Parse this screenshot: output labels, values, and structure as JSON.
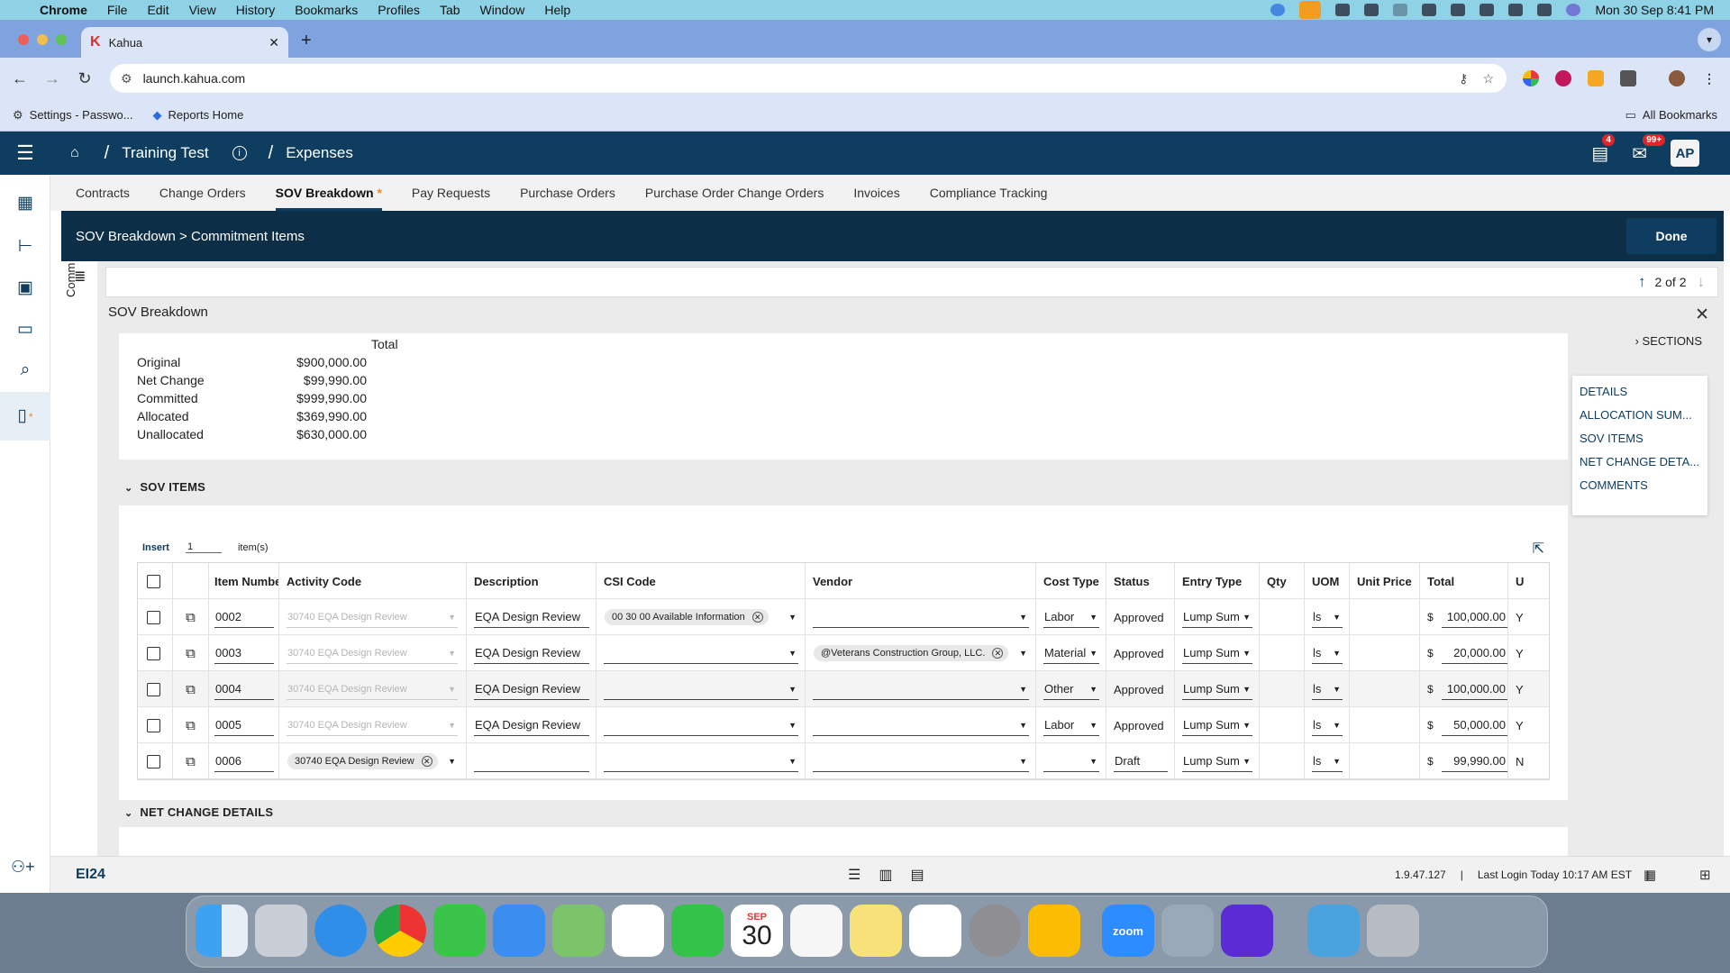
{
  "menubar": {
    "app": "Chrome",
    "items": [
      "File",
      "Edit",
      "View",
      "History",
      "Bookmarks",
      "Profiles",
      "Tab",
      "Window",
      "Help"
    ],
    "datetime": "Mon 30 Sep  8:41 PM"
  },
  "browser": {
    "tab_title": "Kahua",
    "url": "launch.kahua.com",
    "bookmarks": [
      "Settings - Passwo...",
      "Reports Home"
    ],
    "all_bookmarks": "All Bookmarks"
  },
  "app": {
    "breadcrumb": [
      "Training Test",
      "Expenses"
    ],
    "notifications_badge": "4",
    "messages_badge": "99+",
    "avatar": "AP",
    "subnav": [
      {
        "label": "Contracts",
        "active": false
      },
      {
        "label": "Change Orders",
        "active": false
      },
      {
        "label": "SOV Breakdown",
        "active": true,
        "marker": "*"
      },
      {
        "label": "Pay Requests",
        "active": false
      },
      {
        "label": "Purchase Orders",
        "active": false
      },
      {
        "label": "Purchase Order Change Orders",
        "active": false
      },
      {
        "label": "Invoices",
        "active": false
      },
      {
        "label": "Compliance Tracking",
        "active": false
      }
    ],
    "panel_title": "SOV Breakdown > Commitment Items",
    "done_label": "Done",
    "collapsed_label": "Comm",
    "record_position": "2 of 2",
    "form_title": "SOV Breakdown",
    "summary": {
      "header": "Total",
      "rows": [
        {
          "label": "Original",
          "value": "$900,000.00"
        },
        {
          "label": "Net Change",
          "value": "$99,990.00"
        },
        {
          "label": "Committed",
          "value": "$999,990.00"
        },
        {
          "label": "Allocated",
          "value": "$369,990.00"
        },
        {
          "label": "Unallocated",
          "value": "$630,000.00"
        }
      ]
    },
    "sov_section_label": "SOV ITEMS",
    "net_change_section_label": "NET CHANGE DETAILS",
    "insert": {
      "label": "Insert",
      "count": "1",
      "suffix": "item(s)"
    },
    "columns": [
      "Item Number",
      "Activity Code",
      "Description",
      "CSI Code",
      "Vendor",
      "Cost Type",
      "Status",
      "Entry Type",
      "Qty",
      "UOM",
      "Unit Price",
      "Total",
      "U"
    ],
    "rows": [
      {
        "item": "0002",
        "activity": "30740 EQA Design Review",
        "activity_dim": true,
        "description": "EQA Design Review",
        "csi": "00 30 00 Available Information",
        "vendor": "",
        "cost_type": "Labor",
        "status": "Approved",
        "entry_type": "Lump Sum",
        "uom": "ls",
        "currency": "$",
        "total": "100,000.00",
        "u": "Y"
      },
      {
        "item": "0003",
        "activity": "30740 EQA Design Review",
        "activity_dim": true,
        "description": "EQA Design Review",
        "csi": "",
        "vendor": "@Veterans Construction Group, LLC.",
        "cost_type": "Material",
        "status": "Approved",
        "entry_type": "Lump Sum",
        "uom": "ls",
        "currency": "$",
        "total": "20,000.00",
        "u": "Y"
      },
      {
        "item": "0004",
        "activity": "30740 EQA Design Review",
        "activity_dim": true,
        "description": "EQA Design Review",
        "csi": "",
        "vendor": "",
        "cost_type": "Other",
        "status": "Approved",
        "entry_type": "Lump Sum",
        "uom": "ls",
        "currency": "$",
        "total": "100,000.00",
        "u": "Y"
      },
      {
        "item": "0005",
        "activity": "30740 EQA Design Review",
        "activity_dim": true,
        "description": "EQA Design Review",
        "csi": "",
        "vendor": "",
        "cost_type": "Labor",
        "status": "Approved",
        "entry_type": "Lump Sum",
        "uom": "ls",
        "currency": "$",
        "total": "50,000.00",
        "u": "Y"
      },
      {
        "item": "0006",
        "activity": "30740 EQA Design Review",
        "activity_dim": false,
        "description": "",
        "csi": "",
        "vendor": "",
        "cost_type": "",
        "status": "Draft",
        "entry_type": "Lump Sum",
        "uom": "ls",
        "currency": "$",
        "total": "99,990.00",
        "u": "N"
      }
    ],
    "sections": {
      "toggle_label": "SECTIONS",
      "items": [
        "DETAILS",
        "ALLOCATION SUM...",
        "SOV ITEMS",
        "NET CHANGE DETA...",
        "COMMENTS"
      ]
    },
    "footer": {
      "brand": "EI24",
      "version": "1.9.47.127",
      "last_login": "Last Login Today 10:17 AM EST"
    }
  },
  "dock": {
    "zoom_label": "zoom",
    "calendar_month": "SEP",
    "calendar_day": "30"
  },
  "colors": {
    "brand_navy": "#0f3d60",
    "panel_header": "#0d2e47",
    "accent_orange": "#f08a24",
    "badge_red": "#e0252a"
  }
}
